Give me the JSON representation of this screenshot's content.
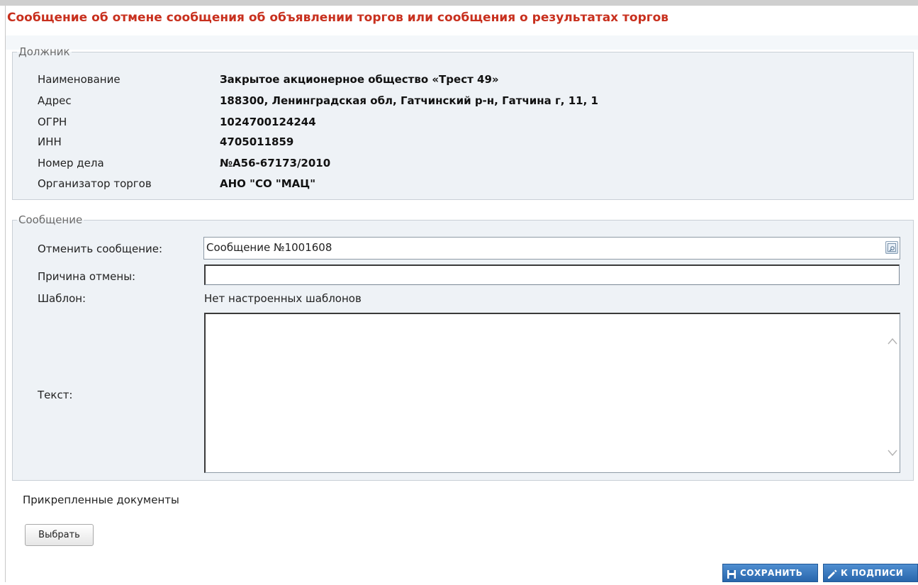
{
  "page": {
    "title": "Сообщение об отмене сообщения об объявлении торгов или сообщения о результатах торгов"
  },
  "debtor": {
    "legend": "Должник",
    "rows": [
      {
        "label": "Наименование",
        "value": "Закрытое акционерное общество «Трест 49»"
      },
      {
        "label": "Адрес",
        "value": "188300, Ленинградская обл, Гатчинский р-н, Гатчина г, 11, 1"
      },
      {
        "label": "ОГРН",
        "value": "1024700124244"
      },
      {
        "label": "ИНН",
        "value": "4705011859"
      },
      {
        "label": "Номер дела",
        "value": "№А56-67173/2010"
      },
      {
        "label": "Организатор торгов",
        "value": "АНО \"СО \"МАЦ\""
      }
    ]
  },
  "message": {
    "legend": "Сообщение",
    "cancel_label": "Отменить сообщение:",
    "cancel_value": "Сообщение №1001608",
    "reason_label": "Причина отмены:",
    "reason_value": "",
    "template_label": "Шаблон:",
    "template_value": "Нет настроенных шаблонов",
    "text_label": "Текст:",
    "text_value": ""
  },
  "attachments": {
    "label": "Прикрепленные документы",
    "select_button": "Выбрать"
  },
  "actions": {
    "save": "СОХРАНИТЬ",
    "to_sign": "К ПОДПИСИ"
  },
  "colors": {
    "title": "#c8301e",
    "panel": "#eef2f6",
    "button_blue": "#2866ac"
  },
  "icons": {
    "lookup": "lookup-icon",
    "save": "save-icon",
    "sign": "pen-icon"
  }
}
